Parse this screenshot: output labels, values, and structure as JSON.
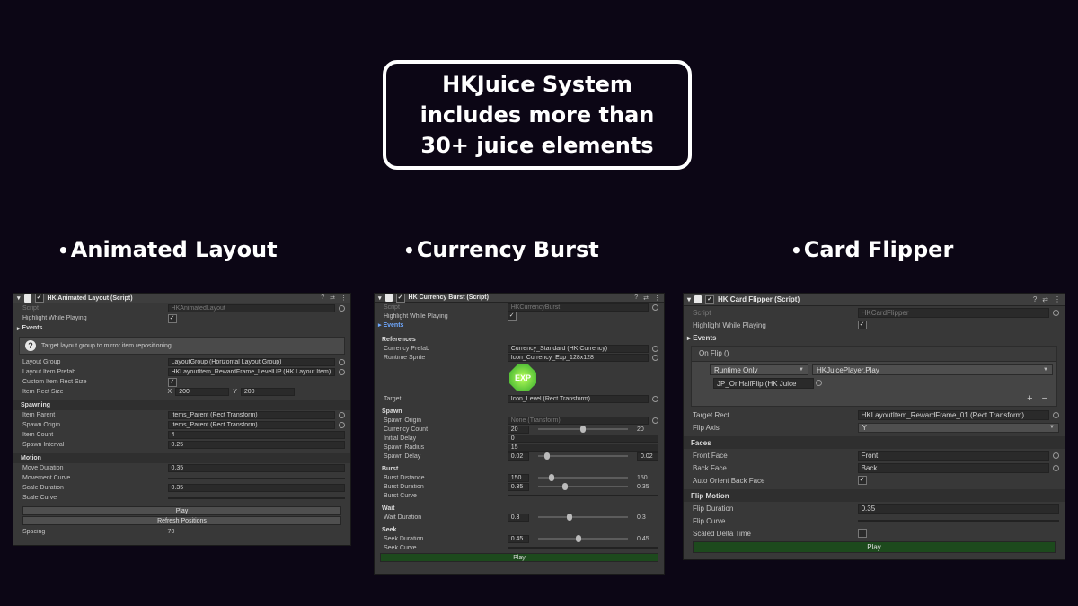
{
  "headline": "HKJuice System includes more than 30+ juice elements",
  "sections": {
    "layout": "Animated Layout",
    "currency": "Currency Burst",
    "flipper": "Card Flipper",
    "bullet": "•"
  },
  "panel1": {
    "title": "HK Animated Layout (Script)",
    "script_label": "Script",
    "script_value": "HKAnimatedLayout",
    "highlight_label": "Highlight While Playing",
    "events_label": "Events",
    "help_text": "Target layout group to mirror item repositioning",
    "layout_group_label": "Layout Group",
    "layout_group_value": "LayoutGroup (Horizontal Layout Group)",
    "item_prefab_label": "Layout Item Prefab",
    "item_prefab_value": "HKLayoutItem_RewardFrame_LevelUP (HK Layout Item)",
    "custom_rect_label": "Custom Item Rect Size",
    "rect_size_label": "Item Rect Size",
    "x_label": "X",
    "x_value": "200",
    "y_label": "Y",
    "y_value": "200",
    "spawning_header": "Spawning",
    "item_parent_label": "Item Parent",
    "item_parent_value": "Items_Parent (Rect Transform)",
    "spawn_origin_label": "Spawn Origin",
    "spawn_origin_value": "Items_Parent (Rect Transform)",
    "item_count_label": "Item Count",
    "item_count_value": "4",
    "spawn_interval_label": "Spawn Interval",
    "spawn_interval_value": "0.25",
    "motion_header": "Motion",
    "move_duration_label": "Move Duration",
    "move_duration_value": "0.35",
    "movement_curve_label": "Movement Curve",
    "scale_duration_label": "Scale Duration",
    "scale_duration_value": "0.35",
    "scale_curve_label": "Scale Curve",
    "play_label": "Play",
    "refresh_label": "Refresh Positions",
    "spacing_label": "Spacing",
    "spacing_value": "70"
  },
  "panel2": {
    "title": "HK Currency Burst (Script)",
    "script_label": "Script",
    "script_value": "HKCurrencyBurst",
    "highlight_label": "Highlight While Playing",
    "events_label": "Events",
    "references_header": "References",
    "currency_prefab_label": "Currency Prefab",
    "currency_prefab_value": "Currency_Standard (HK Currency)",
    "runtime_sprite_label": "Runtime Sprite",
    "runtime_sprite_value": "Icon_Currency_Exp_128x128",
    "exp_badge": "EXP",
    "target_label": "Target",
    "target_value": "Icon_Level (Rect Transform)",
    "spawn_header": "Spawn",
    "spawn_origin_label": "Spawn Origin",
    "spawn_origin_value": "None (Transform)",
    "currency_count_label": "Currency Count",
    "currency_count_min": "20",
    "currency_count_max": "20",
    "initial_delay_label": "Initial Delay",
    "initial_delay_value": "0",
    "spawn_radius_label": "Spawn Radius",
    "spawn_radius_value": "15",
    "spawn_delay_label": "Spawn Delay",
    "spawn_delay_min": "0.02",
    "spawn_delay_max": "0.02",
    "burst_header": "Burst",
    "burst_distance_label": "Burst Distance",
    "burst_distance_min": "150",
    "burst_distance_max": "150",
    "burst_duration_label": "Burst Duration",
    "burst_duration_min": "0.35",
    "burst_duration_max": "0.35",
    "burst_curve_label": "Burst Curve",
    "wait_header": "Wait",
    "wait_duration_label": "Wait Duration",
    "wait_duration_min": "0.3",
    "wait_duration_max": "0.3",
    "seek_header": "Seek",
    "seek_duration_label": "Seek Duration",
    "seek_duration_min": "0.45",
    "seek_duration_max": "0.45",
    "seek_curve_label": "Seek Curve",
    "play_label": "Play"
  },
  "panel3": {
    "title": "HK Card Flipper (Script)",
    "script_label": "Script",
    "script_value": "HKCardFlipper",
    "highlight_label": "Highlight While Playing",
    "events_label": "Events",
    "on_flip_label": "On Flip ()",
    "runtime_only": "Runtime Only",
    "function_value": "HKJuicePlayer.Play",
    "object_value": "JP_OnHalfFlip (HK Juice",
    "plus_label": "+",
    "minus_label": "−",
    "target_rect_label": "Target Rect",
    "target_rect_value": "HKLayoutItem_RewardFrame_01 (Rect Transform)",
    "flip_axis_label": "Flip Axis",
    "flip_axis_value": "Y",
    "faces_header": "Faces",
    "front_face_label": "Front Face",
    "front_face_value": "Front",
    "back_face_label": "Back Face",
    "back_face_value": "Back",
    "auto_orient_label": "Auto Orient Back Face",
    "flip_motion_header": "Flip Motion",
    "flip_duration_label": "Flip Duration",
    "flip_duration_value": "0.35",
    "flip_curve_label": "Flip Curve",
    "scaled_delta_label": "Scaled Delta Time",
    "play_label": "Play"
  },
  "icons": {
    "check": "✓",
    "help": "?",
    "kebab": "⋮",
    "presets": "⇄",
    "fold": "▾",
    "foldout": "▸"
  }
}
